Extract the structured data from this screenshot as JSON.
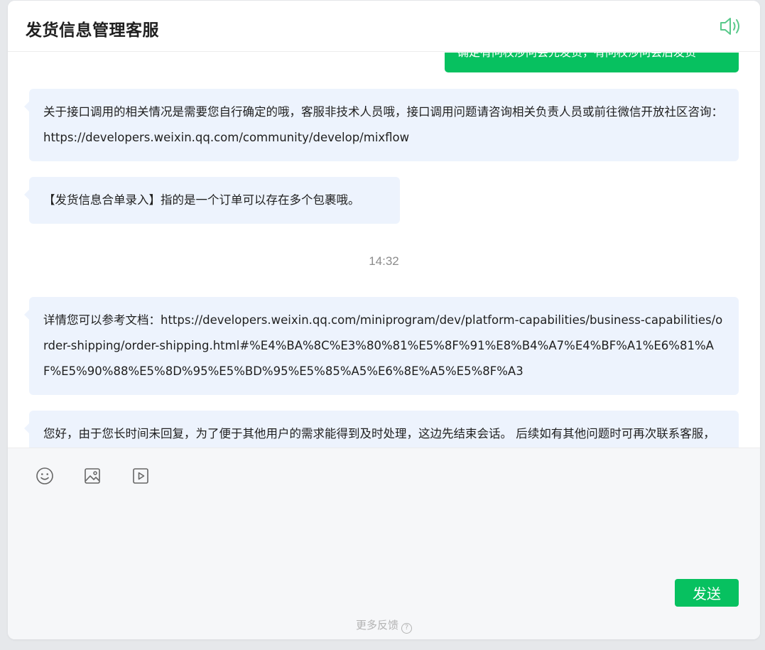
{
  "header": {
    "title": "发货信息管理客服",
    "speaker_icon": "speaker-icon",
    "accent": "#07c160"
  },
  "messages": {
    "user_partial": "确定有问权涉问会先发货，有问权涉问会后发货",
    "bot_1": "关于接口调用的相关情况是需要您自行确定的哦，客服非技术人员哦，接口调用问题请咨询相关负责人员或前往微信开放社区咨询：https://developers.weixin.qq.com/community/develop/mixflow",
    "bot_2": "【发货信息合单录入】指的是一个订单可以存在多个包裹哦。",
    "timestamp": "14:32",
    "bot_3": "详情您可以参考文档：https://developers.weixin.qq.com/miniprogram/dev/platform-capabilities/business-capabilities/order-shipping/order-shipping.html#%E4%BA%8C%E3%80%81%E5%8F%91%E8%B4%A7%E4%BF%A1%E6%81%AF%E5%90%88%E5%8D%95%E5%BD%95%E5%85%A5%E6%8E%A5%E5%8F%A3",
    "bot_4": "您好，由于您长时间未回复，为了便于其他用户的需求能得到及时处理，这边先结束会话。 后续如有其他问题时可再次联系客服，感谢您的理解与支持。"
  },
  "toolbar": {
    "emoji_icon": "emoji-icon",
    "image_icon": "image-icon",
    "video_icon": "video-icon"
  },
  "composer": {
    "send_label": "发送",
    "feedback_label": "更多反馈"
  }
}
